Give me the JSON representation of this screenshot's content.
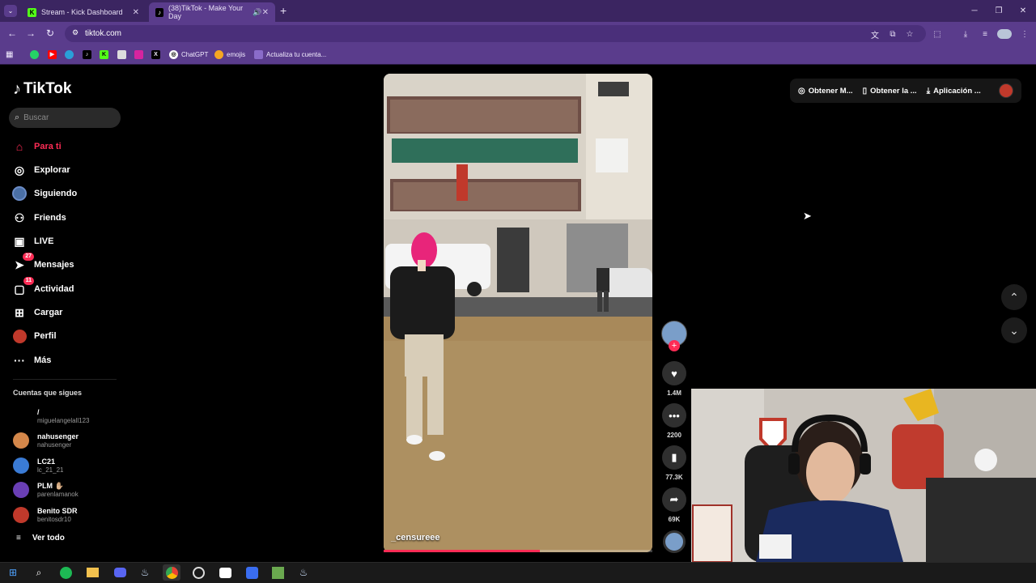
{
  "browser": {
    "tabs": [
      {
        "title": "Stream - Kick Dashboard",
        "favicon": "K",
        "active": false
      },
      {
        "title": "(38)TikTok - Make Your Day",
        "favicon": "♪",
        "active": true
      }
    ],
    "url": "tiktok.com",
    "bookmarks": [
      {
        "label": "ChatGPT"
      },
      {
        "label": "emojis"
      },
      {
        "label": "Actualiza tu cuenta..."
      }
    ]
  },
  "tiktok": {
    "brand": "TikTok",
    "search_placeholder": "Buscar",
    "nav": [
      {
        "label": "Para ti",
        "icon": "home-icon"
      },
      {
        "label": "Explorar",
        "icon": "compass-icon"
      },
      {
        "label": "Siguiendo",
        "icon": "following-icon"
      },
      {
        "label": "Friends",
        "icon": "friends-icon"
      },
      {
        "label": "LIVE",
        "icon": "live-icon"
      },
      {
        "label": "Mensajes",
        "icon": "messages-icon",
        "badge": "27"
      },
      {
        "label": "Actividad",
        "icon": "activity-icon",
        "badge": "11"
      },
      {
        "label": "Cargar",
        "icon": "upload-icon"
      },
      {
        "label": "Perfil",
        "icon": "profile-icon"
      },
      {
        "label": "Más",
        "icon": "more-icon"
      }
    ],
    "following_title": "Cuentas que sigues",
    "following": [
      {
        "name": "/",
        "handle": "miguelangelall123",
        "color": "#000000"
      },
      {
        "name": "nahusenger",
        "handle": "nahusenger",
        "color": "#d4874a"
      },
      {
        "name": "LC21",
        "handle": "lc_21_21",
        "color": "#3a7bd5"
      },
      {
        "name": "PLM ✋🏼",
        "handle": "parenlamanok",
        "color": "#6a3fb5"
      },
      {
        "name": "Benito SDR",
        "handle": "benitosdr10",
        "color": "#c0392b"
      }
    ],
    "see_all": "Ver todo",
    "video": {
      "username": "_censureee",
      "progress": 0.58
    },
    "actions": {
      "likes": "1.4M",
      "comments": "2200",
      "saves": "77.3K",
      "shares": "69K"
    },
    "top_right": [
      {
        "label": "Obtener M...",
        "icon": "coin-icon"
      },
      {
        "label": "Obtener la ...",
        "icon": "phone-icon"
      },
      {
        "label": "Aplicación ...",
        "icon": "download-icon"
      }
    ]
  },
  "colors": {
    "accent": "#fe2c55",
    "chrome": "#5a3c8c",
    "tabbar": "#3b2561"
  }
}
